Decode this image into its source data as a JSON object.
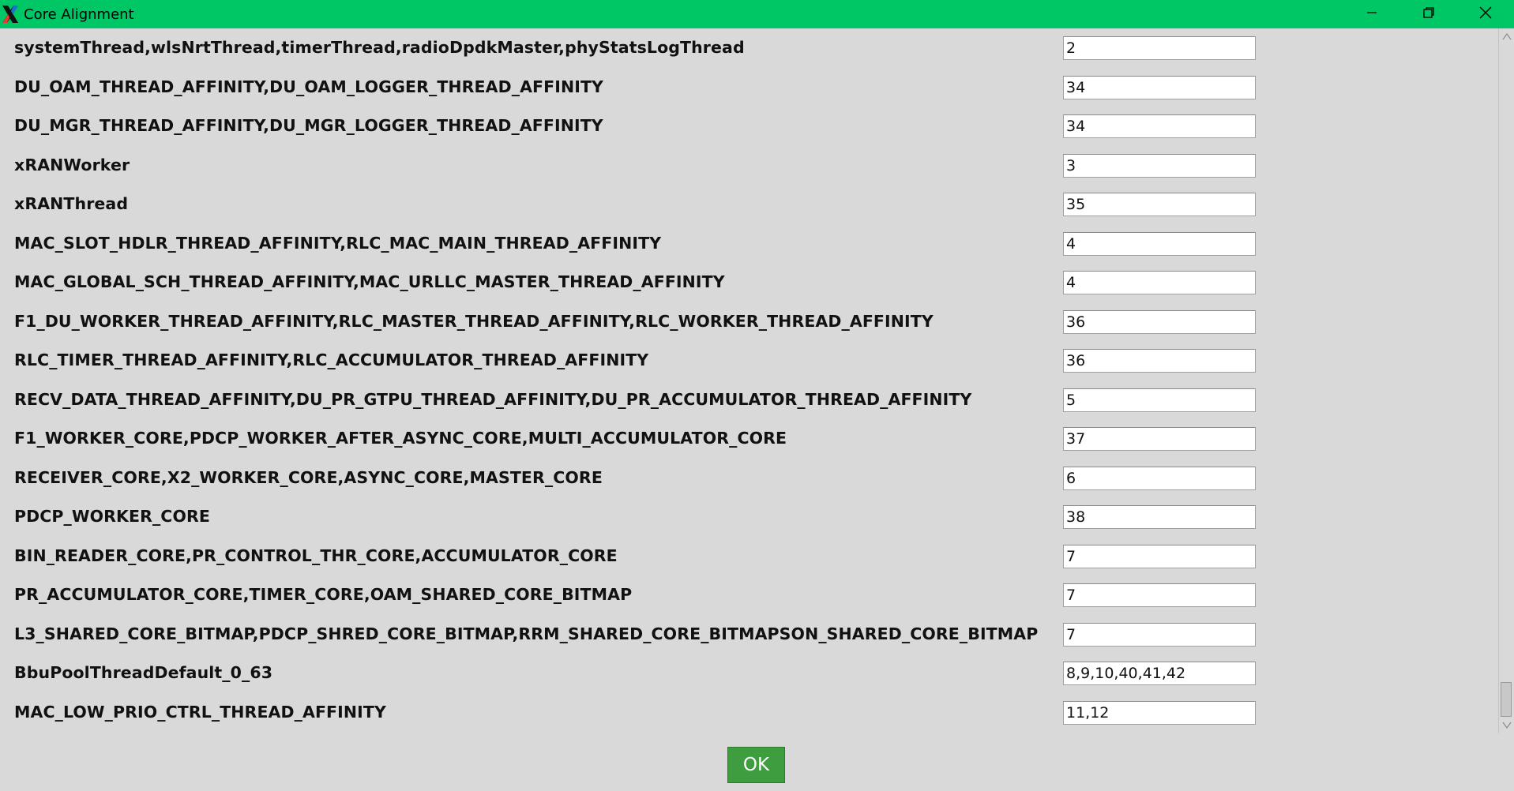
{
  "window": {
    "title": "Core Alignment"
  },
  "rows": [
    {
      "label": "systemThread,wlsNrtThread,timerThread,radioDpdkMaster,phyStatsLogThread",
      "value": "2"
    },
    {
      "label": "DU_OAM_THREAD_AFFINITY,DU_OAM_LOGGER_THREAD_AFFINITY",
      "value": "34"
    },
    {
      "label": "DU_MGR_THREAD_AFFINITY,DU_MGR_LOGGER_THREAD_AFFINITY",
      "value": "34"
    },
    {
      "label": "xRANWorker",
      "value": "3"
    },
    {
      "label": "xRANThread",
      "value": "35"
    },
    {
      "label": "MAC_SLOT_HDLR_THREAD_AFFINITY,RLC_MAC_MAIN_THREAD_AFFINITY",
      "value": "4"
    },
    {
      "label": "MAC_GLOBAL_SCH_THREAD_AFFINITY,MAC_URLLC_MASTER_THREAD_AFFINITY",
      "value": "4"
    },
    {
      "label": "F1_DU_WORKER_THREAD_AFFINITY,RLC_MASTER_THREAD_AFFINITY,RLC_WORKER_THREAD_AFFINITY",
      "value": "36"
    },
    {
      "label": "RLC_TIMER_THREAD_AFFINITY,RLC_ACCUMULATOR_THREAD_AFFINITY",
      "value": "36"
    },
    {
      "label": "RECV_DATA_THREAD_AFFINITY,DU_PR_GTPU_THREAD_AFFINITY,DU_PR_ACCUMULATOR_THREAD_AFFINITY",
      "value": "5"
    },
    {
      "label": "F1_WORKER_CORE,PDCP_WORKER_AFTER_ASYNC_CORE,MULTI_ACCUMULATOR_CORE",
      "value": "37"
    },
    {
      "label": "RECEIVER_CORE,X2_WORKER_CORE,ASYNC_CORE,MASTER_CORE",
      "value": "6"
    },
    {
      "label": "PDCP_WORKER_CORE",
      "value": "38"
    },
    {
      "label": "BIN_READER_CORE,PR_CONTROL_THR_CORE,ACCUMULATOR_CORE",
      "value": "7"
    },
    {
      "label": "PR_ACCUMULATOR_CORE,TIMER_CORE,OAM_SHARED_CORE_BITMAP",
      "value": "7"
    },
    {
      "label": "L3_SHARED_CORE_BITMAP,PDCP_SHRED_CORE_BITMAP,RRM_SHARED_CORE_BITMAPSON_SHARED_CORE_BITMAP",
      "value": "7"
    },
    {
      "label": "BbuPoolThreadDefault_0_63",
      "value": "8,9,10,40,41,42"
    },
    {
      "label": "MAC_LOW_PRIO_CTRL_THREAD_AFFINITY",
      "value": "11,12"
    }
  ],
  "ok_button": {
    "label": "OK"
  },
  "colors": {
    "titlebar": "#00c765",
    "background": "#d9d9d9",
    "ok_button": "#3e9d3e"
  },
  "icons": [
    "x-app-icon",
    "minimize-icon",
    "maximize-icon",
    "close-icon",
    "scroll-up-icon",
    "scroll-down-icon"
  ]
}
